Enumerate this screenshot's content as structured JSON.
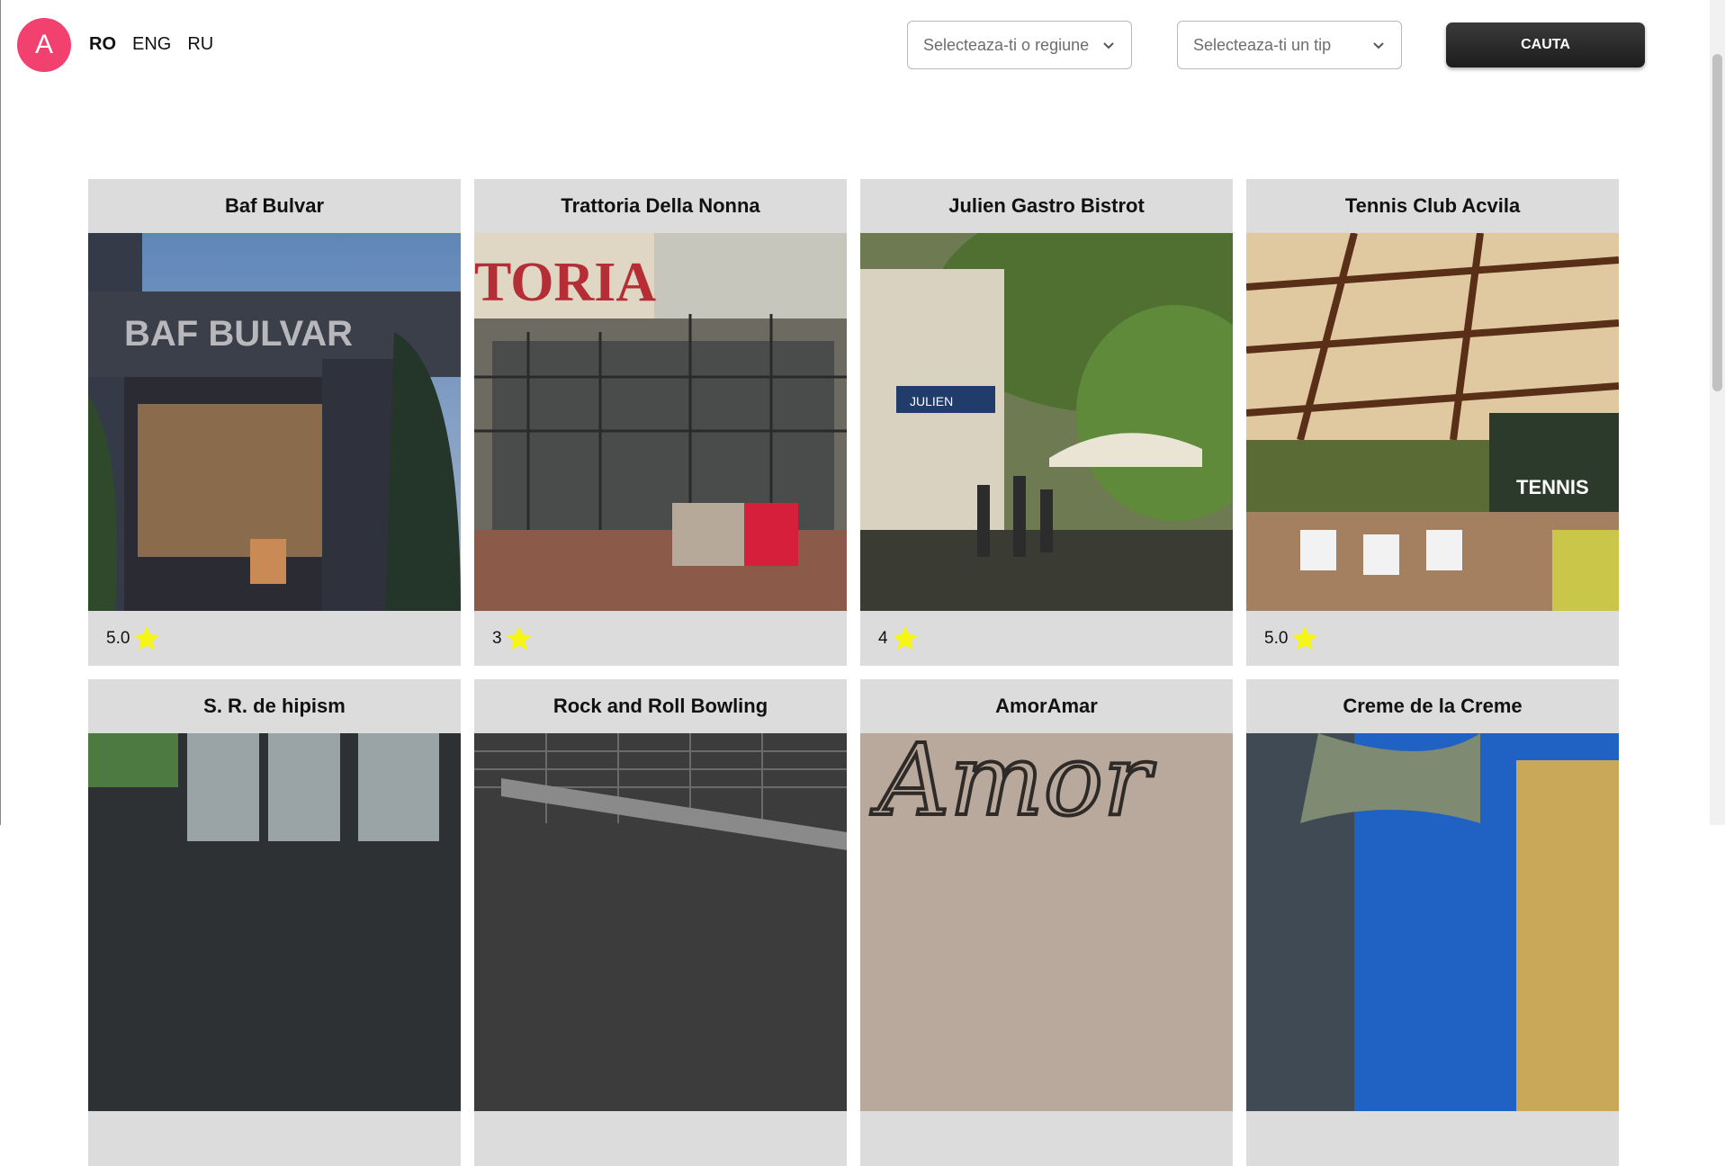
{
  "header": {
    "avatar_letter": "A",
    "languages": [
      {
        "label": "RO",
        "active": true
      },
      {
        "label": "ENG",
        "active": false
      },
      {
        "label": "RU",
        "active": false
      }
    ],
    "region_select": {
      "placeholder": "Selecteaza-ti o regiune"
    },
    "type_select": {
      "placeholder": "Selecteaza-ti un tip"
    },
    "search_label": "CAUTA"
  },
  "colors": {
    "avatar": "#f2406f",
    "star": "#f5f51a",
    "card_bg": "#dcdcdc"
  },
  "venues": [
    {
      "name": "Baf Bulvar",
      "rating": "5.0",
      "photo_text": "BAF BULVAR"
    },
    {
      "name": "Trattoria Della Nonna",
      "rating": "3",
      "photo_text": "TORIA"
    },
    {
      "name": "Julien Gastro Bistrot",
      "rating": "4",
      "photo_text": "JULIEN"
    },
    {
      "name": "Tennis Club Acvila",
      "rating": "5.0",
      "photo_text": "TENNIS"
    },
    {
      "name": "S. R. de hipism",
      "rating": "",
      "photo_text": ""
    },
    {
      "name": "Rock and Roll Bowling",
      "rating": "",
      "photo_text": ""
    },
    {
      "name": "AmorAmar",
      "rating": "",
      "photo_text": "Amor"
    },
    {
      "name": "Creme de la Creme",
      "rating": "",
      "photo_text": ""
    }
  ]
}
